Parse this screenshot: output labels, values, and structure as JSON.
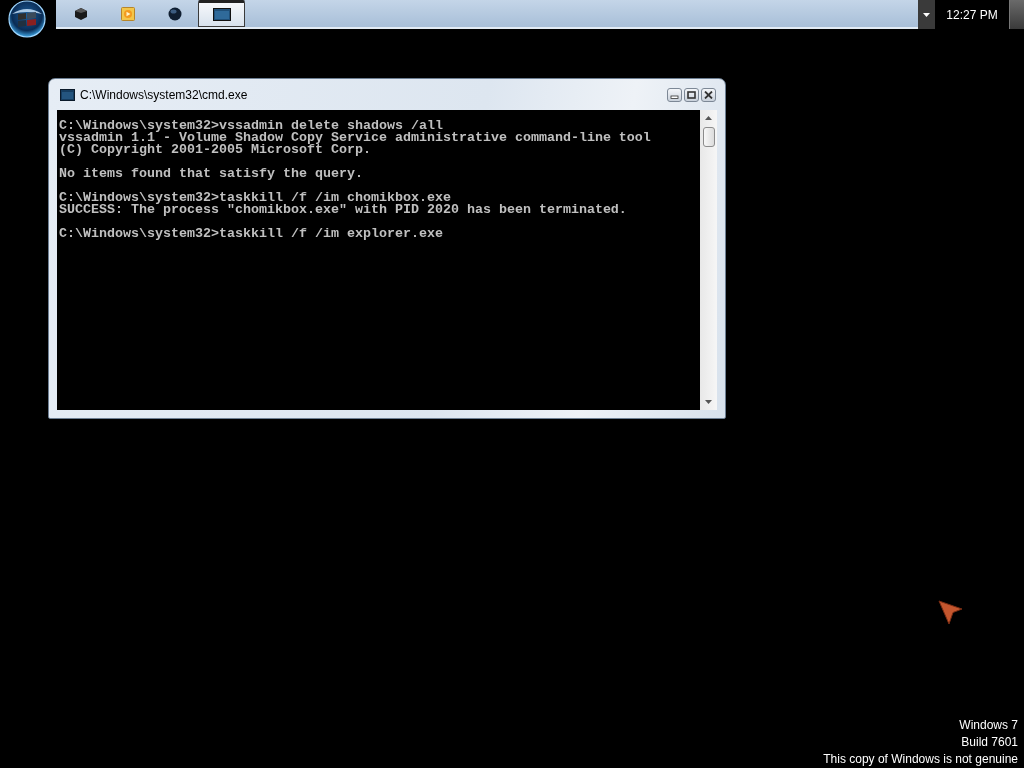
{
  "taskbar": {
    "buttons": [
      {
        "kind": "cube",
        "selected": false
      },
      {
        "kind": "tile",
        "selected": false
      },
      {
        "kind": "sphere",
        "selected": false
      },
      {
        "kind": "console",
        "selected": true
      }
    ],
    "clock": "12:27 PM"
  },
  "window": {
    "title": "C:\\Windows\\system32\\cmd.exe",
    "console_blocks": [
      [
        "C:\\Windows\\system32>vssadmin delete shadows /all",
        "vssadmin 1.1 - Volume Shadow Copy Service administrative command-line tool",
        "(C) Copyright 2001-2005 Microsoft Corp."
      ],
      [
        "No items found that satisfy the query."
      ],
      [
        "C:\\Windows\\system32>taskkill /f /im chomikbox.exe",
        "SUCCESS: The process \"chomikbox.exe\" with PID 2020 has been terminated."
      ],
      [
        "C:\\Windows\\system32>taskkill /f /im explorer.exe"
      ]
    ]
  },
  "desktop": {
    "notice_lines": [
      "Windows 7",
      "Build 7601",
      "This copy of Windows is not genuine"
    ]
  }
}
